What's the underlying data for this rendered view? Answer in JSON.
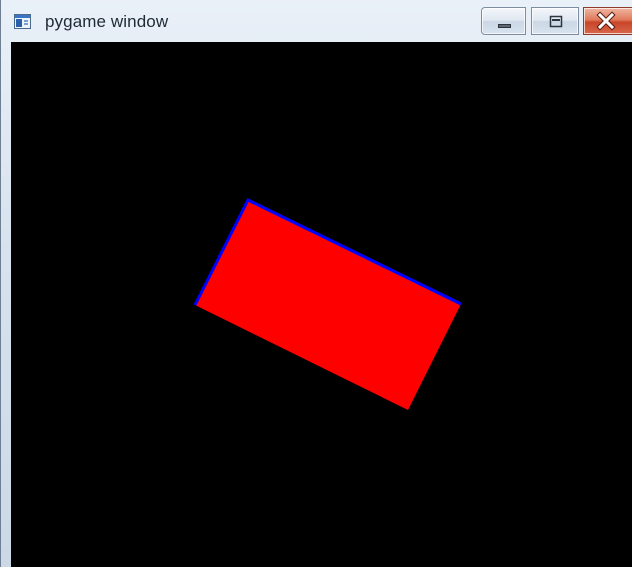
{
  "window": {
    "title": "pygame window",
    "icon": "pygame-app-icon"
  },
  "caption_buttons": [
    {
      "name": "minimize",
      "icon": "minimize-icon"
    },
    {
      "name": "maximize",
      "icon": "maximize-icon"
    },
    {
      "name": "close",
      "icon": "close-icon"
    }
  ],
  "canvas": {
    "background": "#000000",
    "shape": {
      "type": "rotated-rectangle",
      "fill": "#ff0000",
      "outline": "#0000ff"
    }
  }
}
